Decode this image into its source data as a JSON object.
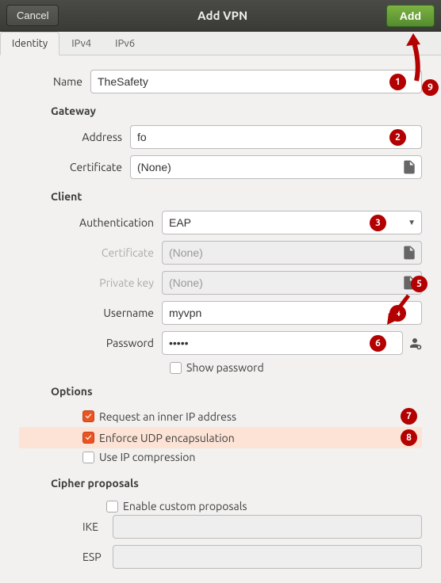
{
  "header": {
    "cancel": "Cancel",
    "title": "Add VPN",
    "add": "Add"
  },
  "tabs": {
    "identity": "Identity",
    "ipv4": "IPv4",
    "ipv6": "IPv6"
  },
  "name": {
    "label": "Name",
    "value": "TheSafety"
  },
  "gateway": {
    "title": "Gateway",
    "address_label": "Address",
    "address_value": "fo",
    "cert_label": "Certificate",
    "cert_value": "(None)"
  },
  "client": {
    "title": "Client",
    "auth_label": "Authentication",
    "auth_value": "EAP",
    "cert_label": "Certificate",
    "cert_value": "(None)",
    "key_label": "Private key",
    "key_value": "(None)",
    "user_label": "Username",
    "user_value": "myvpn",
    "pass_label": "Password",
    "pass_value": "•••••",
    "show_pw": "Show password"
  },
  "options": {
    "title": "Options",
    "inner_ip": "Request an inner IP address",
    "inner_ip_checked": true,
    "udp": "Enforce UDP encapsulation",
    "udp_checked": true,
    "compress": "Use IP compression",
    "compress_checked": false
  },
  "cipher": {
    "title": "Cipher proposals",
    "enable": "Enable custom proposals",
    "ike_label": "IKE",
    "ike_value": "",
    "esp_label": "ESP",
    "esp_value": ""
  },
  "badges": {
    "b1": "1",
    "b2": "2",
    "b3": "3",
    "b4": "4",
    "b5": "5",
    "b6": "6",
    "b7": "7",
    "b8": "8",
    "b9": "9"
  },
  "checkmark": "✓"
}
